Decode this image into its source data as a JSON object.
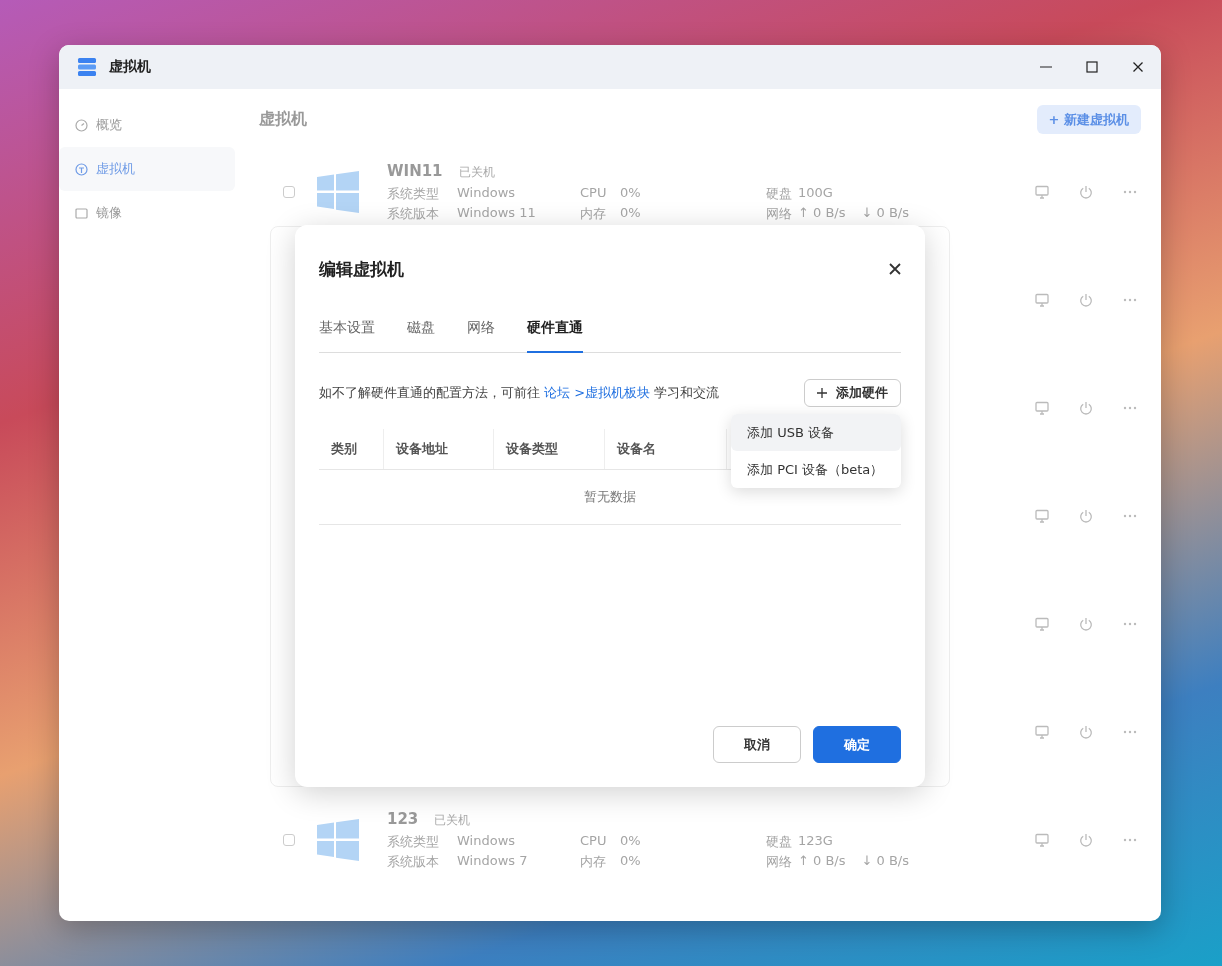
{
  "window": {
    "title": "虚拟机"
  },
  "sidebar": {
    "items": [
      {
        "label": "概览",
        "selected": false
      },
      {
        "label": "虚拟机",
        "selected": true
      },
      {
        "label": "镜像",
        "selected": false
      }
    ]
  },
  "main": {
    "heading": "虚拟机",
    "new_button": "+ 新建虚拟机"
  },
  "vm_rows": [
    {
      "kind": "full",
      "checked": false,
      "name": "WIN11",
      "status": "已关机",
      "fields": [
        [
          {
            "label": "系统类型",
            "value": "Windows"
          },
          {
            "label": "系统版本",
            "value": "Windows 11"
          }
        ],
        [
          {
            "label": "CPU",
            "value": "0%"
          },
          {
            "label": "内存",
            "value": "0%"
          }
        ],
        [
          {
            "label": "硬盘",
            "value": "100G"
          },
          {
            "label": "网络",
            "value": "↑ 0 B/s",
            "value2": "↓ 0 B/s"
          }
        ]
      ]
    },
    {
      "kind": "covered"
    },
    {
      "kind": "covered"
    },
    {
      "kind": "covered"
    },
    {
      "kind": "covered"
    },
    {
      "kind": "covered"
    },
    {
      "kind": "full",
      "checked": false,
      "name": "123",
      "status": "已关机",
      "fields": [
        [
          {
            "label": "系统类型",
            "value": "Windows"
          },
          {
            "label": "系统版本",
            "value": "Windows 7"
          }
        ],
        [
          {
            "label": "CPU",
            "value": "0%"
          },
          {
            "label": "内存",
            "value": "0%"
          }
        ],
        [
          {
            "label": "硬盘",
            "value": "123G"
          },
          {
            "label": "网络",
            "value": "↑ 0 B/s",
            "value2": "↓ 0 B/s"
          }
        ]
      ]
    }
  ],
  "dialog": {
    "title": "编辑虚拟机",
    "tabs": [
      {
        "label": "基本设置",
        "selected": false
      },
      {
        "label": "磁盘",
        "selected": false
      },
      {
        "label": "网络",
        "selected": false
      },
      {
        "label": "硬件直通",
        "selected": true
      }
    ],
    "info": {
      "before": "如不了解硬件直通的配置方法，可前往 ",
      "link": "论坛 >虚拟机板块",
      "after": " 学习和交流"
    },
    "add_button": "添加硬件",
    "table": {
      "columns": [
        "类别",
        "设备地址",
        "设备类型",
        "设备名"
      ],
      "empty_text": "暂无数据"
    },
    "menu": [
      {
        "label": "添加 USB 设备",
        "selected": true
      },
      {
        "label": "添加 PCI 设备（beta）",
        "selected": false
      }
    ],
    "buttons": {
      "cancel": "取消",
      "ok": "确定"
    }
  }
}
